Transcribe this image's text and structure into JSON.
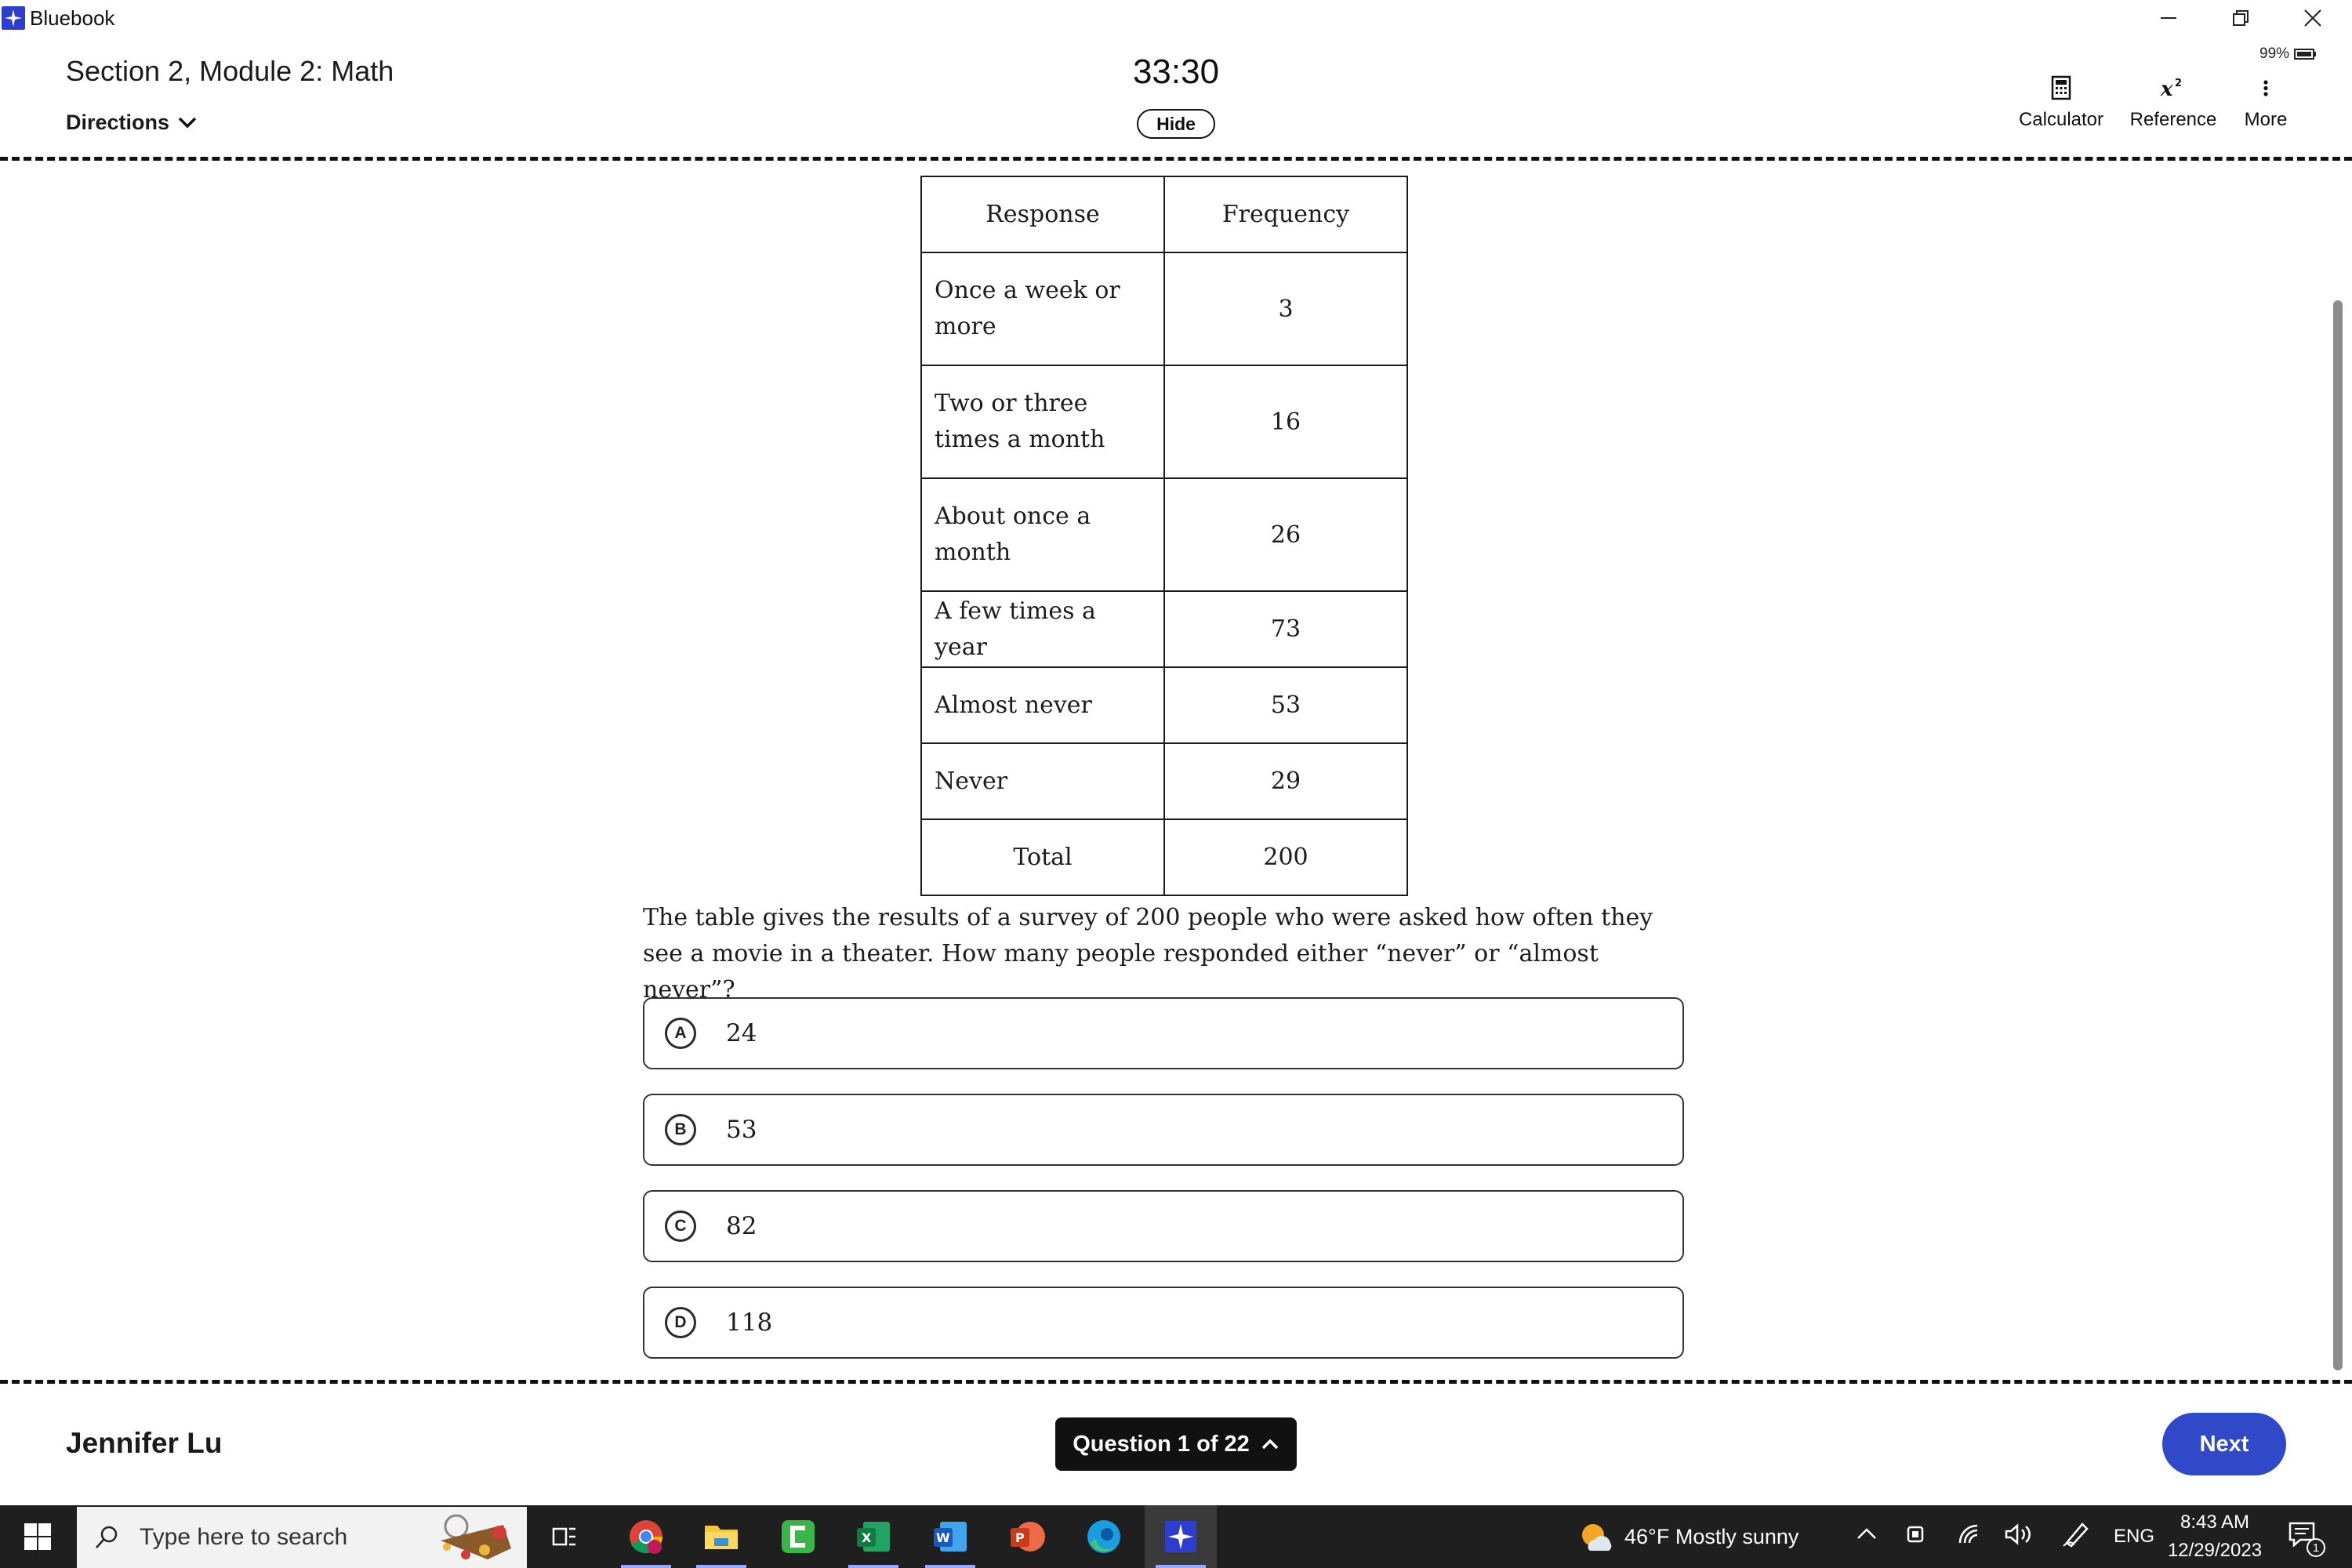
{
  "window": {
    "app_name": "Bluebook",
    "controls": [
      "minimize",
      "restore",
      "close"
    ]
  },
  "header": {
    "section_title": "Section 2, Module 2: Math",
    "directions_label": "Directions",
    "timer": "33:30",
    "hide_label": "Hide",
    "battery": "99%",
    "tools": [
      {
        "label": "Calculator",
        "icon": "calculator-icon"
      },
      {
        "label": "Reference",
        "icon": "formula-reference-icon"
      },
      {
        "label": "More",
        "icon": "more-vertical-icon"
      }
    ]
  },
  "table": {
    "headers": [
      "Response",
      "Frequency"
    ],
    "rows": [
      {
        "response": "Once a week or more",
        "frequency": "3"
      },
      {
        "response": "Two or three times a month",
        "frequency": "16"
      },
      {
        "response": "About once a month",
        "frequency": "26"
      },
      {
        "response": "A few times a year",
        "frequency": "73"
      },
      {
        "response": "Almost never",
        "frequency": "53"
      },
      {
        "response": "Never",
        "frequency": "29"
      }
    ],
    "total_label": "Total",
    "total_value": "200"
  },
  "question": {
    "text": "The table gives the results of a survey of 200 people who were asked how often they see a movie in a theater. How many people responded either “never” or “almost never”?"
  },
  "choices": [
    {
      "letter": "A",
      "text": "24"
    },
    {
      "letter": "B",
      "text": "53"
    },
    {
      "letter": "C",
      "text": "82"
    },
    {
      "letter": "D",
      "text": "118"
    }
  ],
  "footer": {
    "student_name": "Jennifer Lu",
    "question_nav": "Question 1 of 22",
    "next_label": "Next"
  },
  "taskbar": {
    "search_placeholder": "Type here to search",
    "apps": [
      "task-view",
      "chrome",
      "file-explorer",
      "camtasia",
      "excel",
      "word",
      "powerpoint",
      "edge",
      "bluebook"
    ],
    "weather": "46°F  Mostly sunny",
    "language": "ENG",
    "time": "8:43 AM",
    "date": "12/29/2023",
    "notification_count": "1",
    "colors": {
      "taskbar": "#1f1f1f",
      "accent": "#3049c8"
    }
  }
}
